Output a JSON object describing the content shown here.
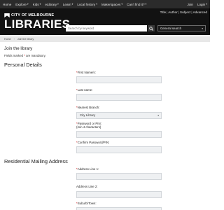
{
  "topnav": {
    "left": [
      {
        "label": "Home",
        "caret": false
      },
      {
        "label": "Explore",
        "caret": true
      },
      {
        "label": "Kids",
        "caret": true
      },
      {
        "label": "eLibrary",
        "caret": true
      },
      {
        "label": "Learn",
        "caret": true
      },
      {
        "label": "Local history",
        "caret": true
      },
      {
        "label": "Makerspaces",
        "caret": true
      },
      {
        "label": "Can't find it?",
        "caret": true
      }
    ],
    "right": [
      {
        "label": "Join",
        "caret": false
      },
      {
        "label": "Login",
        "caret": true
      }
    ]
  },
  "header": {
    "logo_city": "CITY OF MELBOURNE",
    "logo_libraries": "LIBRARIES",
    "util_links": [
      "Title",
      "Author",
      "Subject",
      "Advanced"
    ],
    "util_sep": "|",
    "search_placeholder": "Search by keyword",
    "search_scope": "General search"
  },
  "breadcrumb": [
    "Home",
    "Join the library"
  ],
  "page": {
    "title": "Join the library",
    "mandatory_prefix": "Fields marked ",
    "mandatory_star": "*",
    "mandatory_suffix": " are mandatory."
  },
  "personal": {
    "heading": "Personal Details",
    "first_name": "First Name/s:",
    "last_name": "Last name:",
    "nearest_branch": "Nearest Branch:",
    "branch_value": "City Library",
    "password": "Password or PIN:",
    "password_hint": "(min 4 characters)",
    "confirm_password": "Confirm Password/PIN:"
  },
  "mailing": {
    "heading": "Residential Mailing Address",
    "address1": "Address Line 1:",
    "address2": "Address Line 2:",
    "suburb": "Suburb/Town:"
  },
  "icons": {
    "search": "search-icon",
    "caret": "chevron-down-icon",
    "logo": "city-of-melbourne-logo-icon"
  }
}
